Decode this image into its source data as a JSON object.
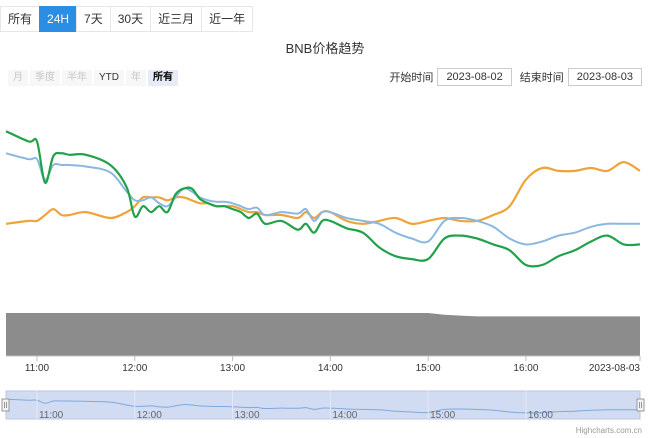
{
  "tabs": [
    "所有",
    "24H",
    "7天",
    "30天",
    "近三月",
    "近一年"
  ],
  "active_tab": "24H",
  "range_selector": {
    "buttons": [
      "月",
      "季度",
      "半年",
      "YTD",
      "年",
      "所有"
    ],
    "enabled": [
      "YTD",
      "所有"
    ],
    "selected": "所有"
  },
  "date_inputs": {
    "start_label": "开始时间",
    "start_value": "2023-08-02",
    "end_label": "结束时间",
    "end_value": "2023-08-03"
  },
  "credit": "Highcharts.com.cn",
  "colors": {
    "green": "#21a14a",
    "blue": "#8ab8e0",
    "orange": "#eea43a",
    "volume": "#8c8c8c",
    "navigator_fill": "#c9d6f0",
    "navigator_line": "#7fa8dc",
    "tab_active": "#2b8de3"
  },
  "chart_data": {
    "type": "line",
    "title": "BNB价格趋势",
    "xlabel": "",
    "ylabel": "",
    "x_tick_labels": [
      "11:00",
      "12:00",
      "13:00",
      "14:00",
      "15:00",
      "16:00",
      "2023-08-03"
    ],
    "x_range": [
      "10:41",
      "17:10"
    ],
    "y_axis_labels_shown": false,
    "y_range": [
      0,
      100
    ],
    "legend": "none",
    "grid": false,
    "x": [
      "10:41",
      "10:55",
      "11:00",
      "11:05",
      "11:10",
      "11:15",
      "11:20",
      "11:30",
      "11:45",
      "11:55",
      "12:00",
      "12:05",
      "12:10",
      "12:15",
      "12:20",
      "12:25",
      "12:30",
      "12:35",
      "12:40",
      "12:45",
      "12:50",
      "12:55",
      "13:00",
      "13:05",
      "13:10",
      "13:15",
      "13:20",
      "13:30",
      "13:40",
      "13:45",
      "13:50",
      "13:55",
      "14:00",
      "14:10",
      "14:20",
      "14:30",
      "14:40",
      "14:50",
      "15:00",
      "15:10",
      "15:20",
      "15:30",
      "15:40",
      "15:50",
      "16:00",
      "16:10",
      "16:20",
      "16:30",
      "16:40",
      "16:50",
      "17:00",
      "17:10"
    ],
    "series": [
      {
        "color": "green",
        "values": [
          91,
          84,
          84,
          56,
          74,
          76,
          75,
          75,
          68,
          53,
          33,
          40,
          36,
          40,
          36,
          48,
          52,
          52,
          45,
          42,
          40,
          40,
          38,
          36,
          32,
          35,
          28,
          30,
          24,
          28,
          22,
          30,
          30,
          25,
          22,
          12,
          6,
          4,
          4,
          18,
          20,
          18,
          14,
          10,
          0,
          0,
          6,
          10,
          16,
          20,
          14,
          14
        ]
      },
      {
        "color": "blue",
        "values": [
          76,
          72,
          72,
          58,
          68,
          68,
          68,
          67,
          63,
          50,
          44,
          44,
          46,
          42,
          40,
          46,
          52,
          50,
          46,
          44,
          43,
          43,
          42,
          40,
          38,
          39,
          34,
          36,
          35,
          38,
          30,
          36,
          36,
          32,
          30,
          28,
          22,
          18,
          16,
          30,
          32,
          30,
          26,
          18,
          14,
          16,
          20,
          22,
          26,
          28,
          28,
          28
        ]
      },
      {
        "color": "orange",
        "values": [
          28,
          30,
          30,
          34,
          38,
          34,
          34,
          36,
          32,
          36,
          40,
          46,
          46,
          46,
          44,
          46,
          46,
          44,
          42,
          42,
          40,
          40,
          40,
          38,
          36,
          36,
          34,
          34,
          32,
          36,
          32,
          36,
          36,
          30,
          28,
          30,
          32,
          28,
          30,
          32,
          30,
          30,
          34,
          40,
          58,
          66,
          64,
          64,
          66,
          64,
          70,
          64
        ]
      }
    ],
    "volume": {
      "x": [
        "10:41",
        "14:30",
        "15:00",
        "15:10",
        "15:20",
        "15:30",
        "16:00",
        "17:10"
      ],
      "values": [
        100,
        100,
        100,
        96,
        94,
        92,
        92,
        92
      ],
      "color": "volume"
    }
  }
}
